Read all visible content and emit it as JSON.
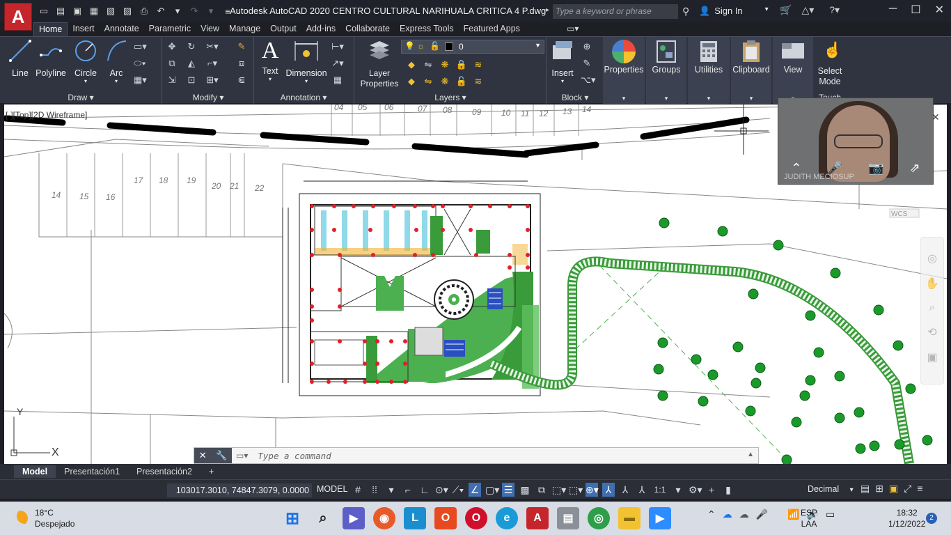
{
  "window": {
    "title": "Autodesk AutoCAD 2020    CENTRO CULTURAL NARIHUALA CRITICA 4 P.dwg",
    "app_logo": "A",
    "search_placeholder": "Type a keyword or phrase",
    "sign_in": "Sign In"
  },
  "ribbon": {
    "tabs": [
      "Home",
      "Insert",
      "Annotate",
      "Parametric",
      "View",
      "Manage",
      "Output",
      "Add-ins",
      "Collaborate",
      "Express Tools",
      "Featured Apps"
    ],
    "active_tab": "Home",
    "panels": {
      "draw": {
        "title": "Draw",
        "tools": [
          "Line",
          "Polyline",
          "Circle",
          "Arc"
        ]
      },
      "modify": {
        "title": "Modify"
      },
      "annotation": {
        "title": "Annotation",
        "tools": [
          "Text",
          "Dimension"
        ]
      },
      "layers": {
        "title": "Layers",
        "tool": "Layer Properties",
        "current_layer": "0"
      },
      "block": {
        "title": "Block",
        "tool": "Insert"
      },
      "properties": "Properties",
      "groups": "Groups",
      "utilities": "Utilities",
      "clipboard": "Clipboard",
      "view": "View",
      "select_mode": "Select Mode",
      "touch": "Touch"
    }
  },
  "viewport": {
    "label": "[-][Top][2D Wireframe]",
    "wcs": "WCS",
    "axis_x": "X",
    "axis_y": "Y",
    "lot_numbers_top": [
      "04",
      "05",
      "06",
      "07",
      "08",
      "09",
      "10",
      "11",
      "12",
      "13",
      "14"
    ],
    "lot_numbers_left": [
      "14",
      "15",
      "16",
      "17",
      "18",
      "19",
      "20",
      "21",
      "22"
    ]
  },
  "video": {
    "participant": "JUDITH MECIOSUP"
  },
  "command": {
    "placeholder": "Type a command"
  },
  "layout_tabs": [
    "Model",
    "Presentación1",
    "Presentación2"
  ],
  "status": {
    "coordinates": "103017.3010, 74847.3079, 0.0000",
    "space": "MODEL",
    "scale": "1:1",
    "units": "Decimal"
  },
  "taskbar": {
    "temperature": "18°C",
    "weather": "Despejado",
    "language": "ESP",
    "keyboard": "LAA",
    "time": "18:32",
    "date": "1/12/2022",
    "notifications": "2"
  }
}
